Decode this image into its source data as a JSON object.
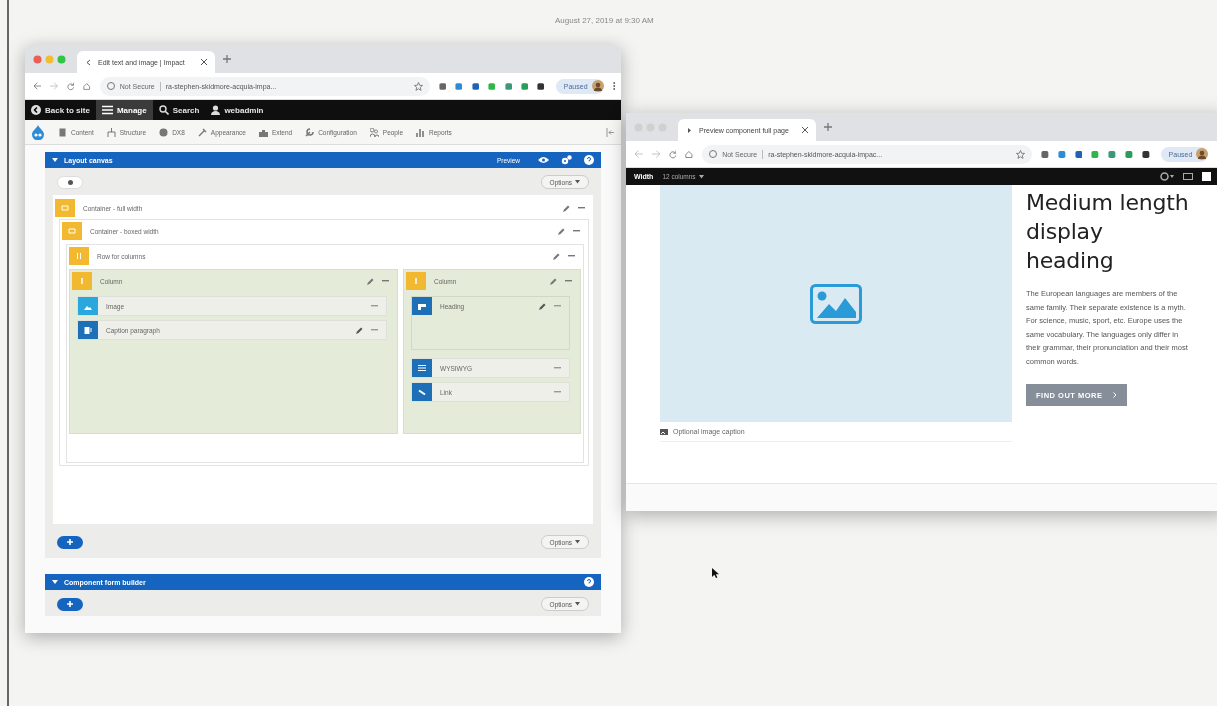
{
  "desktop": {
    "timestamp": "August 27, 2019 at 9:30 AM"
  },
  "editor_window": {
    "tab_title": "Edit text and image | Impact",
    "address": {
      "security": "Not Secure",
      "url": "ra-stephen-skidmore-acquia-impa..."
    },
    "profile": "Paused",
    "admin_bar": [
      {
        "label": "Back to site",
        "kind": "back",
        "selected": false
      },
      {
        "label": "Manage",
        "kind": "menu",
        "selected": true
      },
      {
        "label": "Search",
        "kind": "search",
        "selected": false
      },
      {
        "label": "webadmin",
        "kind": "user",
        "selected": false
      }
    ],
    "admin_menu": [
      {
        "label": "Content",
        "kind": "content"
      },
      {
        "label": "Structure",
        "kind": "structure"
      },
      {
        "label": "DX8",
        "kind": "dx8"
      },
      {
        "label": "Appearance",
        "kind": "appearance"
      },
      {
        "label": "Extend",
        "kind": "extend"
      },
      {
        "label": "Configuration",
        "kind": "configuration"
      },
      {
        "label": "People",
        "kind": "people"
      },
      {
        "label": "Reports",
        "kind": "reports"
      }
    ],
    "layout_panel": {
      "title": "Layout canvas",
      "expanded": true,
      "action": "Preview",
      "options_top": "Options",
      "options_bottom": "Options"
    },
    "tree": [
      {
        "label": "Container - full width",
        "kind": "container",
        "children": [
          {
            "label": "Container - boxed width",
            "kind": "container",
            "children": [
              {
                "label": "Row for columns",
                "kind": "row",
                "children": [
                  {
                    "label": "Column",
                    "kind": "column",
                    "children": [
                      {
                        "label": "Image",
                        "kind": "image",
                        "color": "#2aa7dc",
                        "editable": false
                      },
                      {
                        "label": "Caption paragraph",
                        "kind": "text",
                        "color": "#1d6fb8",
                        "editable": true
                      }
                    ]
                  },
                  {
                    "label": "Column",
                    "kind": "column",
                    "children": [
                      {
                        "label": "Heading",
                        "kind": "heading",
                        "color": "#1d6fb8",
                        "editable": true
                      },
                      {
                        "label": "WYSIWYG",
                        "kind": "wysiwyg",
                        "color": "#1d6fb8",
                        "editable": false
                      },
                      {
                        "label": "Link",
                        "kind": "link",
                        "color": "#1d6fb8",
                        "editable": false
                      }
                    ]
                  }
                ]
              }
            ]
          }
        ]
      }
    ],
    "builder_panel": {
      "title": "Component form builder",
      "expanded": true,
      "options": "Options"
    }
  },
  "preview_window": {
    "tab_title": "Preview component full page",
    "address": {
      "security": "Not Secure",
      "url": "ra-stephen-skidmore-acquia-impac..."
    },
    "profile": "Paused",
    "toolbar": {
      "label": "Width",
      "value": "12 columns"
    },
    "heading": "Medium length display heading",
    "paragraph": "The European languages are members of the same family. Their separate existence is a myth. For science, music, sport, etc. Europe uses the same vocabulary. The languages only differ in their grammar, their pronunciation and their most common words.",
    "button": "FIND OUT MORE",
    "caption": "Optional image caption"
  }
}
